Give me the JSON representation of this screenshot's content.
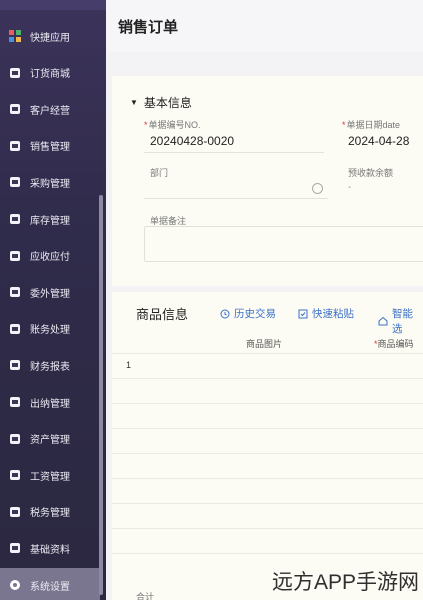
{
  "sidebar": {
    "items": [
      {
        "label": "快捷应用",
        "icon": "grid-icon"
      },
      {
        "label": "订货商城",
        "icon": "bag-icon"
      },
      {
        "label": "客户经营",
        "icon": "user-icon"
      },
      {
        "label": "销售管理",
        "icon": "chart-icon"
      },
      {
        "label": "采购管理",
        "icon": "cart-icon"
      },
      {
        "label": "库存管理",
        "icon": "box-icon"
      },
      {
        "label": "应收应付",
        "icon": "coin-icon"
      },
      {
        "label": "委外管理",
        "icon": "stamp-icon"
      },
      {
        "label": "账务处理",
        "icon": "ledger-icon"
      },
      {
        "label": "财务报表",
        "icon": "report-icon"
      },
      {
        "label": "出纳管理",
        "icon": "cashier-icon"
      },
      {
        "label": "资产管理",
        "icon": "asset-icon"
      },
      {
        "label": "工资管理",
        "icon": "salary-icon"
      },
      {
        "label": "税务管理",
        "icon": "tax-icon"
      },
      {
        "label": "基础资料",
        "icon": "layers-icon"
      },
      {
        "label": "系统设置",
        "icon": "gear-icon"
      }
    ],
    "active_index": 15
  },
  "header": {
    "title": "销售订单"
  },
  "basic_info": {
    "title": "基本信息",
    "order_no_label": "单据编号NO.",
    "order_no_value": "20240428-0020",
    "date_label": "单据日期date",
    "date_value": "2024-04-28",
    "dept_label": "部门",
    "prepay_label": "预收款余额",
    "prepay_value": "-",
    "remark_label": "单据备注"
  },
  "product_info": {
    "title": "商品信息",
    "buttons": [
      "历史交易",
      "快速粘贴",
      "智能选"
    ],
    "columns": [
      "商品图片",
      "商品编码"
    ],
    "rows": [
      "1"
    ],
    "footer": "合计"
  },
  "watermark": "远方APP手游网",
  "colors": {
    "sidebar_bg": "#2f2b4a",
    "accent": "#3a6fc7",
    "required": "#d33333",
    "card_bg": "#fdfcf4"
  }
}
